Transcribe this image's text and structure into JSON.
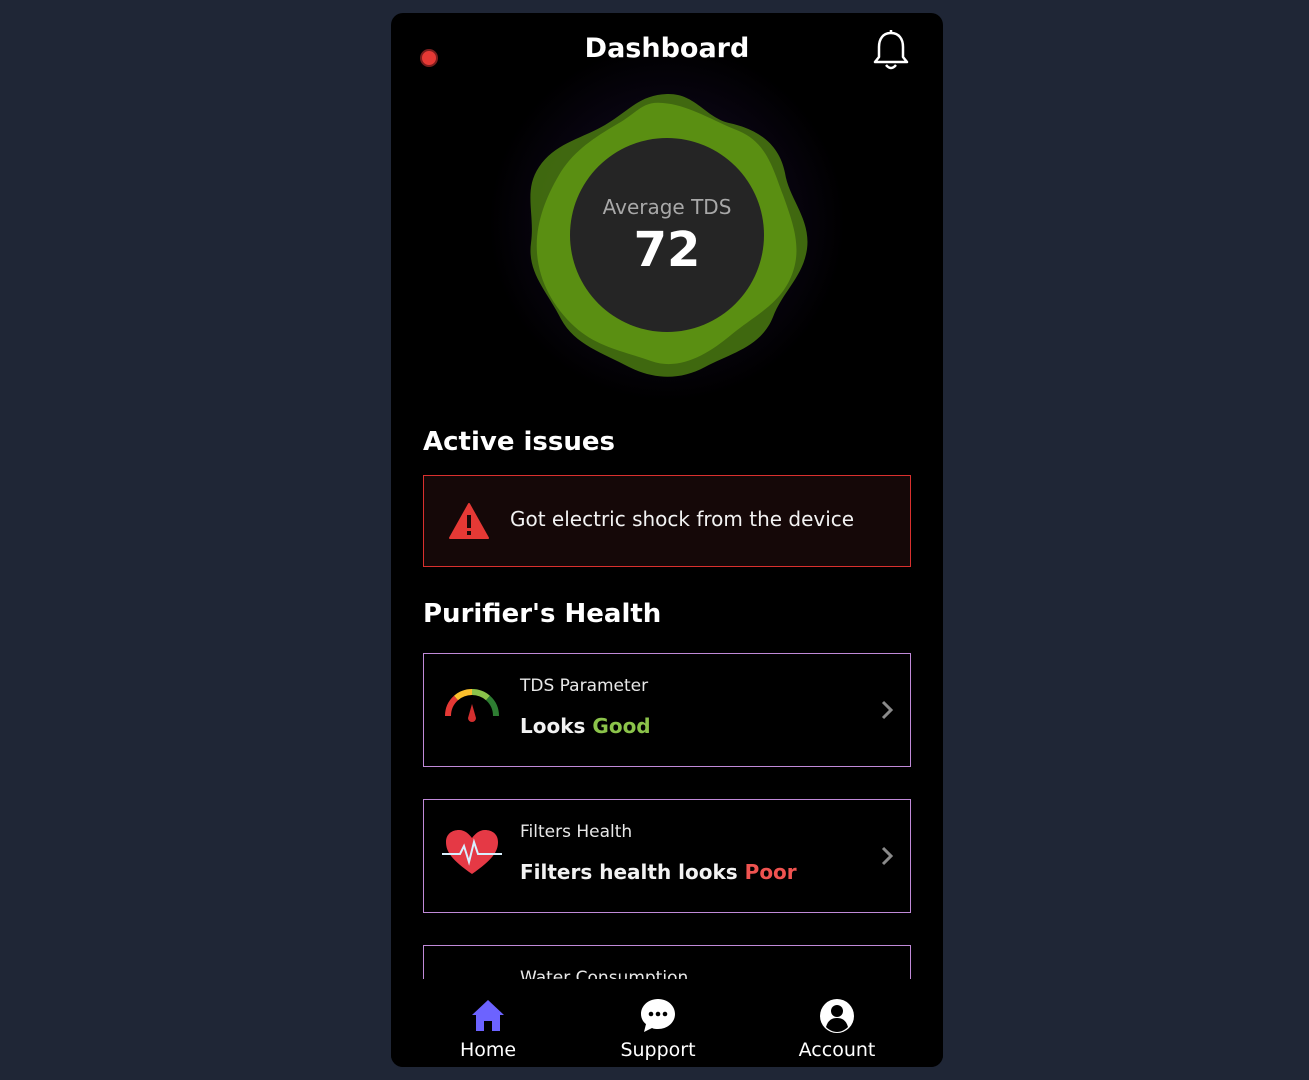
{
  "header": {
    "title": "Dashboard"
  },
  "tds": {
    "label": "Average TDS",
    "value": "72"
  },
  "issues": {
    "title": "Active issues",
    "items": [
      {
        "text": "Got electric shock from the device"
      }
    ]
  },
  "health": {
    "title": "Purifier's Health",
    "cards": [
      {
        "label": "TDS Parameter",
        "status_prefix": "Looks ",
        "status_value": "Good",
        "status_color": "#8bc34a",
        "icon": "gauge-icon"
      },
      {
        "label": "Filters Health",
        "status_prefix": "Filters health looks ",
        "status_value": "Poor",
        "status_color": "#ef5350",
        "icon": "heart-pulse-icon"
      },
      {
        "label": "Water Consumption",
        "icon": "water-drop-icon"
      }
    ]
  },
  "nav": {
    "items": [
      {
        "label": "Home",
        "icon": "home-icon",
        "color": "#6c63ff"
      },
      {
        "label": "Support",
        "icon": "chat-icon"
      },
      {
        "label": "Account",
        "icon": "account-icon"
      }
    ]
  },
  "colors": {
    "page_background": "#1f2636",
    "blob": "#5a8f12",
    "issue_border": "#d9302e",
    "card_border": "#c08ad8",
    "status_dot": "#e53935"
  }
}
